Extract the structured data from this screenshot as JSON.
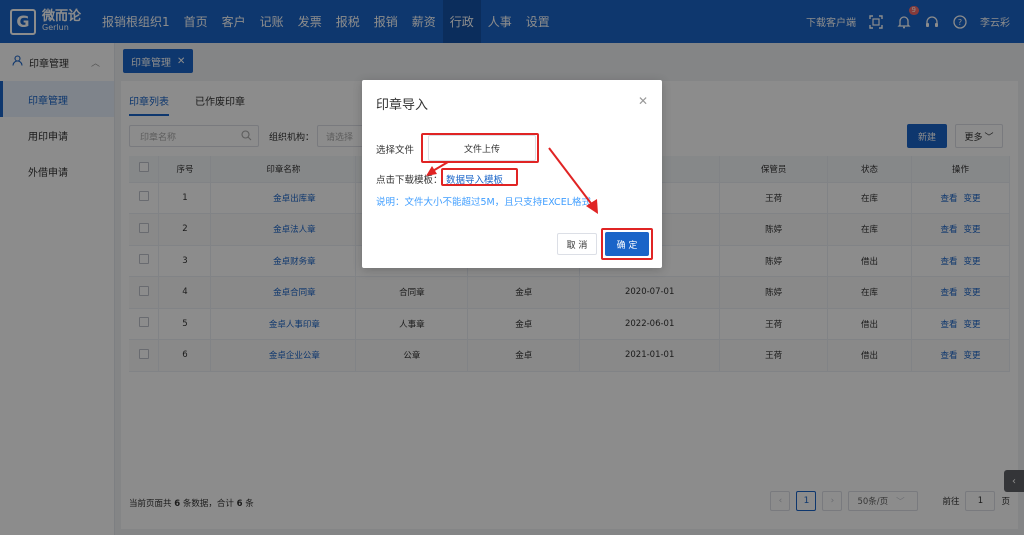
{
  "app": {
    "logo_mark": "G",
    "logo_cn": "微而论",
    "logo_en": "Gerlun"
  },
  "nav": [
    {
      "label": "报销根组织1"
    },
    {
      "label": "首页"
    },
    {
      "label": "客户"
    },
    {
      "label": "记账"
    },
    {
      "label": "发票"
    },
    {
      "label": "报税"
    },
    {
      "label": "报销"
    },
    {
      "label": "薪资"
    },
    {
      "label": "行政",
      "active": true
    },
    {
      "label": "人事"
    },
    {
      "label": "设置"
    }
  ],
  "topright": {
    "download": "下载客户端",
    "badge": "9",
    "user": "李云彩"
  },
  "sidebar": {
    "section": "印章管理",
    "items": [
      {
        "label": "印章管理",
        "active": true
      },
      {
        "label": "用印申请"
      },
      {
        "label": "外借申请"
      }
    ]
  },
  "page_tab": {
    "label": "印章管理"
  },
  "subtabs": [
    {
      "label": "印章列表",
      "active": true
    },
    {
      "label": "已作废印章"
    }
  ],
  "filters": {
    "seal_name_placeholder": "印章名称",
    "org_label": "组织机构：",
    "org_placeholder": "请选择",
    "new_button": "新建",
    "more_button": "更多"
  },
  "table": {
    "headers": [
      "序号",
      "印章名称",
      "",
      "",
      "",
      "保管员",
      "状态",
      "操作"
    ],
    "rows": [
      {
        "no": "1",
        "name": "金卓出库章",
        "type": "",
        "org": "",
        "date": "",
        "keeper": "王荷",
        "status": "在库",
        "out": false
      },
      {
        "no": "2",
        "name": "金卓法人章",
        "type": "",
        "org": "",
        "date": "",
        "keeper": "陈婷",
        "status": "在库",
        "out": false
      },
      {
        "no": "3",
        "name": "金卓财务章",
        "type": "",
        "org": "",
        "date": "",
        "keeper": "陈婷",
        "status": "借出",
        "out": true
      },
      {
        "no": "4",
        "name": "金卓合同章",
        "type": "合同章",
        "org": "金卓",
        "date": "2020-07-01",
        "keeper": "陈婷",
        "status": "在库",
        "out": false
      },
      {
        "no": "5",
        "name": "金卓人事印章",
        "type": "人事章",
        "org": "金卓",
        "date": "2022-06-01",
        "keeper": "王荷",
        "status": "借出",
        "out": true
      },
      {
        "no": "6",
        "name": "金卓企业公章",
        "type": "公章",
        "org": "金卓",
        "date": "2021-01-01",
        "keeper": "王荷",
        "status": "借出",
        "out": true
      }
    ],
    "op_view": "查看",
    "op_change": "变更"
  },
  "footer": {
    "summary_prefix": "当前页面共",
    "count": "6",
    "summary_mid": "条数据，合计",
    "total": "6",
    "summary_suffix": "条",
    "current_page": "1",
    "page_size": "50条/页",
    "goto_label": "前往",
    "goto_value": "1",
    "page_unit": "页"
  },
  "modal": {
    "title": "印章导入",
    "file_label": "选择文件",
    "upload_button": "文件上传",
    "template_label": "点击下载模板：",
    "template_link": "数据导入模板",
    "note": "说明：文件大小不能超过5M，且只支持EXCEL格式",
    "cancel_button": "取 消",
    "ok_button": "确 定"
  },
  "colors": {
    "primary": "#1a64c8",
    "danger": "#f56c6c",
    "annotation": "#e02424"
  }
}
